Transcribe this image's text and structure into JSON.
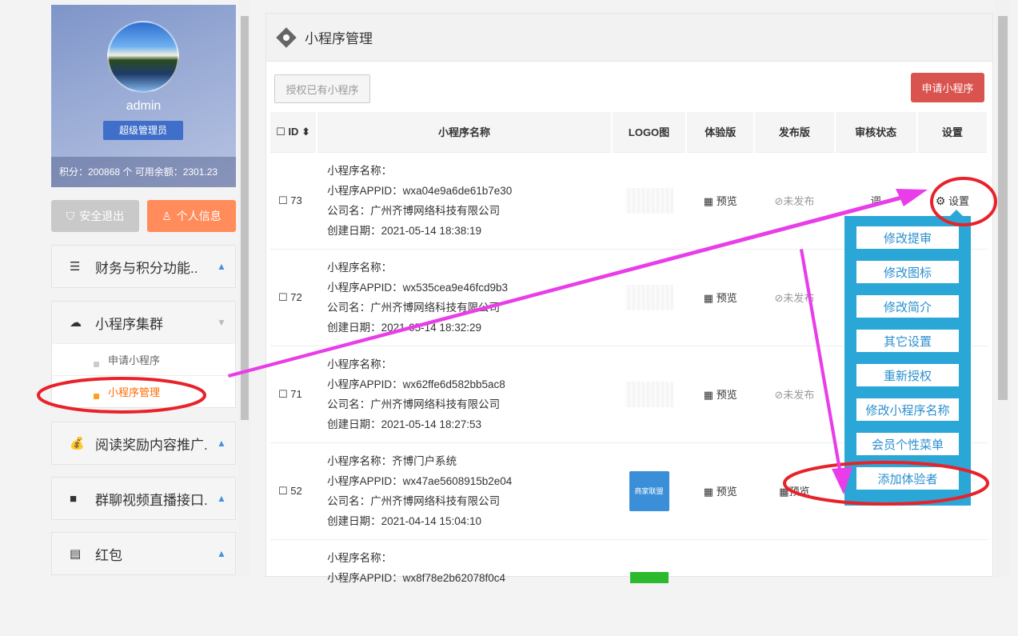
{
  "sidebar": {
    "username": "admin",
    "role": "超级管理员",
    "stats": "积分：200868 个 可用余额：2301.23",
    "logout_label": "安全退出",
    "profile_label": "个人信息",
    "groups": [
      {
        "label": "财务与积分功能.."
      },
      {
        "label": "小程序集群",
        "items": [
          {
            "label": "申请小程序"
          },
          {
            "label": "小程序管理"
          }
        ]
      },
      {
        "label": "阅读奖励内容推广.."
      },
      {
        "label": "群聊视频直播接口.."
      },
      {
        "label": "红包"
      }
    ]
  },
  "main": {
    "title": "小程序管理",
    "authorize_label": "授权已有小程序",
    "apply_label": "申请小程序",
    "columns": [
      "ID",
      "小程序名称",
      "LOGO图",
      "体验版",
      "发布版",
      "审核状态",
      "设置"
    ],
    "rows": [
      {
        "id": "73",
        "name": "小程序名称：",
        "appid": "小程序APPID：wxa04e9a6de61b7e30",
        "company": "公司名：广州齐博网络科技有限公司",
        "date": "创建日期：2021-05-14 18:38:19",
        "exp": "预览",
        "pub": "未发布",
        "review": "调",
        "setting": "设置"
      },
      {
        "id": "72",
        "name": "小程序名称：",
        "appid": "小程序APPID：wx535cea9e46fcd9b3",
        "company": "公司名：广州齐博网络科技有限公司",
        "date": "创建日期：2021-05-14 18:32:29",
        "exp": "预览",
        "pub": "未发布",
        "review": "",
        "setting": ""
      },
      {
        "id": "71",
        "name": "小程序名称：",
        "appid": "小程序APPID：wx62ffe6d582bb5ac8",
        "company": "公司名：广州齐博网络科技有限公司",
        "date": "创建日期：2021-05-14 18:27:53",
        "exp": "预览",
        "pub": "未发布",
        "review": "",
        "setting": ""
      },
      {
        "id": "52",
        "name": "小程序名称：齐博门户系统",
        "appid": "小程序APPID：wx47ae5608915b2e04",
        "company": "公司名：广州齐博网络科技有限公司",
        "date": "创建日期：2021-04-14 15:04:10",
        "exp": "预览",
        "pub": "预览",
        "review": "",
        "setting": "",
        "logo_text": "商家联盟"
      },
      {
        "id": "",
        "name": "小程序名称：",
        "appid": "小程序APPID：wx8f78e2b62078f0c4",
        "company": "",
        "date": "",
        "exp": "",
        "pub": "",
        "review": "",
        "setting": ""
      }
    ]
  },
  "dropdown": {
    "items": [
      "修改提审",
      "修改图标",
      "修改简介",
      "其它设置",
      "重新授权",
      "修改小程序名称",
      "会员个性菜单",
      "添加体验者"
    ]
  },
  "colors": {
    "accent": "#ff6a00",
    "annotation_red": "#e8222a",
    "annotation_magenta": "#e83de8",
    "dropdown_bg": "#2aa7d6",
    "danger_button": "#d9534f"
  }
}
